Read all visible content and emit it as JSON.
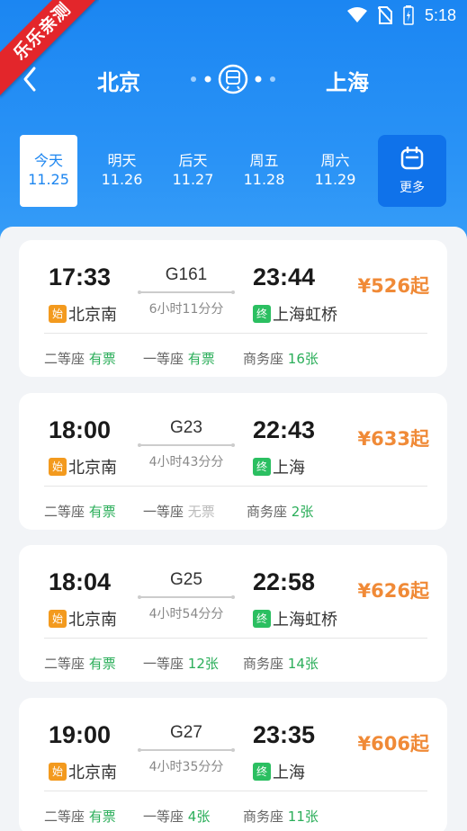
{
  "status_bar": {
    "time": "5:18",
    "ribbon_text": "乐乐亲测"
  },
  "nav": {
    "from_city": "北京",
    "to_city": "上海"
  },
  "date_tabs": [
    {
      "day": "今天",
      "date": "11.25",
      "active": true
    },
    {
      "day": "明天",
      "date": "11.26"
    },
    {
      "day": "后天",
      "date": "11.27"
    },
    {
      "day": "周五",
      "date": "11.28"
    },
    {
      "day": "周六",
      "date": "11.29"
    }
  ],
  "more_label": "更多",
  "trains": [
    {
      "dep_time": "17:33",
      "arr_time": "23:44",
      "train_no": "G161",
      "duration": "6小时11分分",
      "from_station": "北京南",
      "to_station": "上海虹桥",
      "price": "¥526起",
      "start_tag": "始",
      "end_tag": "终",
      "seats": [
        {
          "name": "二等座",
          "status": "有票"
        },
        {
          "name": "一等座",
          "status": "有票"
        },
        {
          "name": "商务座",
          "status": "16张"
        }
      ]
    },
    {
      "dep_time": "18:00",
      "arr_time": "22:43",
      "train_no": "G23",
      "duration": "4小时43分分",
      "from_station": "北京南",
      "to_station": "上海",
      "price": "¥633起",
      "start_tag": "始",
      "end_tag": "终",
      "seats": [
        {
          "name": "二等座",
          "status": "有票"
        },
        {
          "name": "一等座",
          "status": "无票",
          "unavailable": true
        },
        {
          "name": "商务座",
          "status": "2张"
        }
      ]
    },
    {
      "dep_time": "18:04",
      "arr_time": "22:58",
      "train_no": "G25",
      "duration": "4小时54分分",
      "from_station": "北京南",
      "to_station": "上海虹桥",
      "price": "¥626起",
      "start_tag": "始",
      "end_tag": "终",
      "seats": [
        {
          "name": "二等座",
          "status": "有票"
        },
        {
          "name": "一等座",
          "status": "12张"
        },
        {
          "name": "商务座",
          "status": "14张"
        }
      ]
    },
    {
      "dep_time": "19:00",
      "arr_time": "23:35",
      "train_no": "G27",
      "duration": "4小时35分分",
      "from_station": "北京南",
      "to_station": "上海",
      "price": "¥606起",
      "start_tag": "始",
      "end_tag": "终",
      "seats": [
        {
          "name": "二等座",
          "status": "有票"
        },
        {
          "name": "一等座",
          "status": "4张"
        },
        {
          "name": "商务座",
          "status": "11张"
        }
      ]
    }
  ],
  "colors": {
    "header": "#1b86f2",
    "price": "#f08a37",
    "available": "#2bae5a",
    "start_tag": "#f39a1e",
    "end_tag": "#2bbf61"
  }
}
